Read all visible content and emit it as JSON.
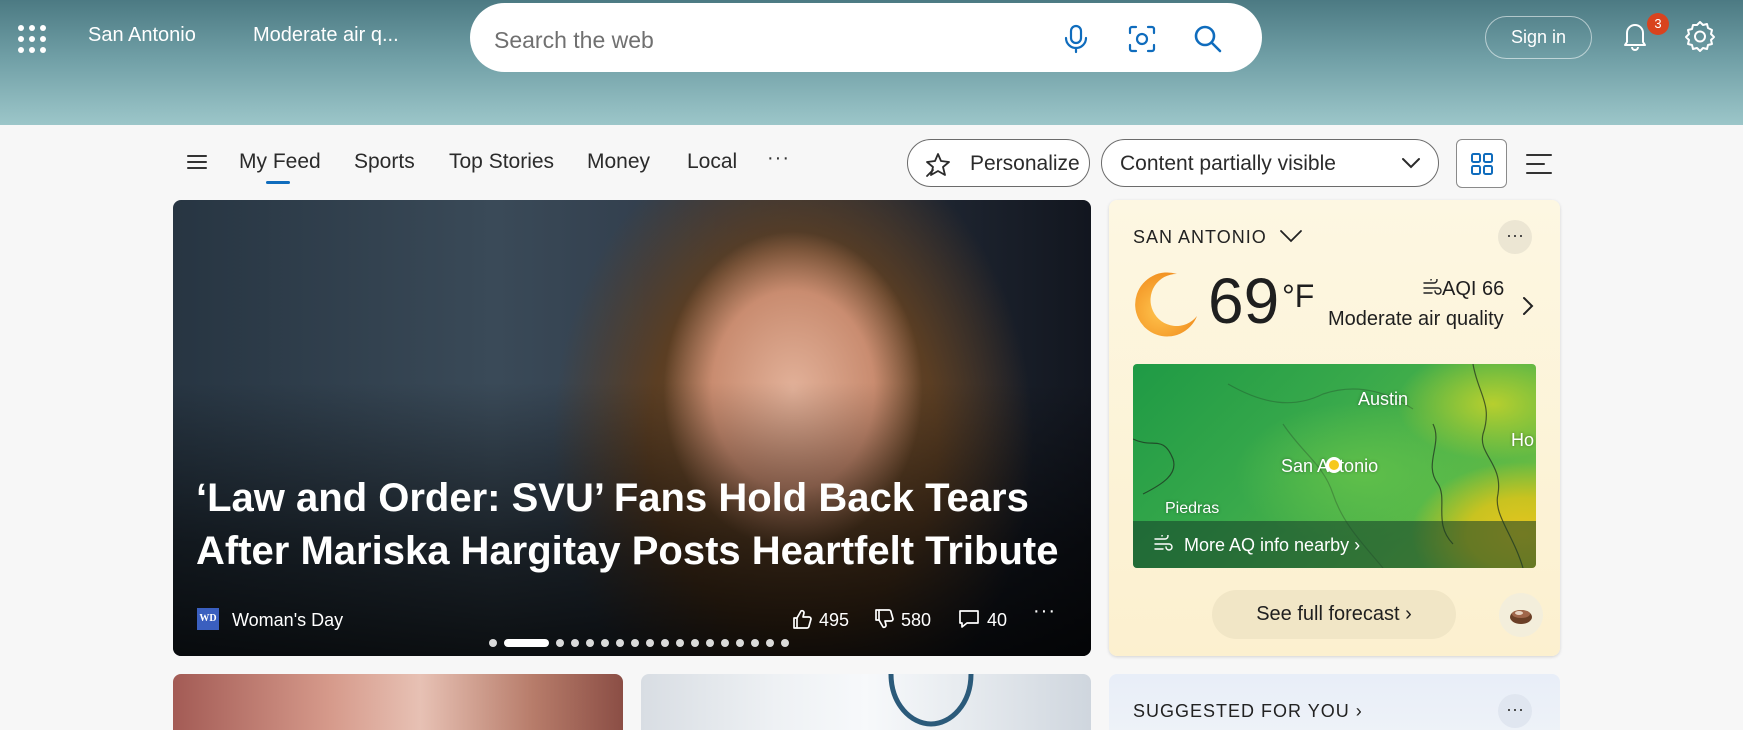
{
  "header": {
    "location": "San Antonio",
    "air_quality": "Moderate air q...",
    "search_placeholder": "Search the web",
    "sign_in": "Sign in",
    "notification_count": "3"
  },
  "nav": {
    "tabs": [
      {
        "label": "My Feed",
        "active": true
      },
      {
        "label": "Sports"
      },
      {
        "label": "Top Stories"
      },
      {
        "label": "Money"
      },
      {
        "label": "Local"
      }
    ],
    "more": "···",
    "personalize": "Personalize",
    "content_filter": "Content partially visible"
  },
  "hero": {
    "title": "‘Law and Order: SVU’ Fans Hold Back Tears After Mariska Hargitay Posts Heartfelt Tribute",
    "source_logo": "WD",
    "source": "Woman's Day",
    "likes": "495",
    "dislikes": "580",
    "comments": "40",
    "more": "···",
    "carousel": {
      "total": 18,
      "active_index": 1
    }
  },
  "weather": {
    "location": "SAN ANTONIO",
    "more": "···",
    "temperature": "69",
    "unit": "°F",
    "aqi": "AQI 66",
    "aqi_text": "Moderate air quality",
    "map_labels": {
      "city1": "Austin",
      "city2": "San Antonio",
      "city3": "Piedras",
      "city4": "Ho"
    },
    "aq_link": "More AQ info nearby ›",
    "forecast_button": "See full forecast ›"
  },
  "suggested": {
    "title": "SUGGESTED FOR YOU ›",
    "more": "···"
  },
  "colors": {
    "accent": "#0f6cbd",
    "badge": "#d9431e",
    "header_bg": "#4c7a83"
  },
  "icons": [
    "apps-grid-icon",
    "microphone-icon",
    "visual-search-icon",
    "search-icon",
    "bell-icon",
    "gear-icon",
    "hamburger-icon",
    "sparkle-star-icon",
    "chevron-down-icon",
    "grid-view-icon",
    "list-view-icon",
    "thumbs-up-icon",
    "thumbs-down-icon",
    "comment-icon",
    "moon-icon",
    "air-quality-icon",
    "chevron-right-icon",
    "coffee-icon"
  ]
}
